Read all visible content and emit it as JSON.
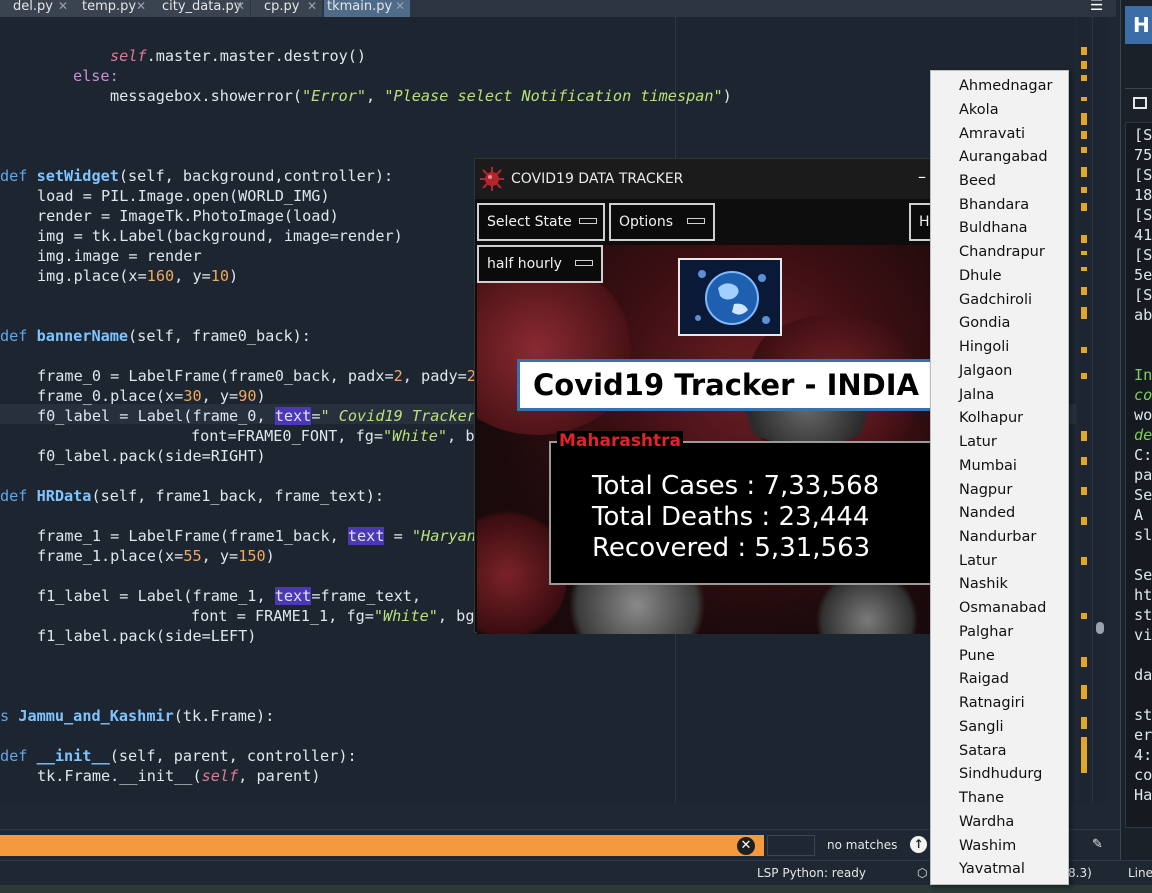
{
  "tabs": [
    {
      "label": "del.py"
    },
    {
      "label": "temp.py"
    },
    {
      "label": "city_data.py"
    },
    {
      "label": "cp.py"
    },
    {
      "label": "tkmain.py"
    }
  ],
  "code": {
    "line1_self": "self",
    "line1_rest": ".master.master.destroy()",
    "line2": "else:",
    "line3_a": "messagebox.showerror(",
    "line3_s1": "\"Error\"",
    "line3_b": ", ",
    "line3_s2": "\"Please select Notification timespan\"",
    "line3_c": ")",
    "setwidget_def": "def",
    "setwidget_name": "setWidget",
    "setwidget_args": "(self, background,controller):",
    "sw1": "load = PIL.Image.open(WORLD_IMG)",
    "sw2": "render = ImageTk.PhotoImage(load)",
    "sw3": "img = tk.Label(background, image=render)",
    "sw4": "img.image = render",
    "sw5_a": "img.place(x=",
    "sw5_n1": "160",
    "sw5_b": ", y=",
    "sw5_n2": "10",
    "sw5_c": ")",
    "banner_def": "def",
    "banner_name": "bannerName",
    "banner_args": "(self, frame0_back):",
    "b1_a": "frame_0 = LabelFrame(frame0_back, padx=",
    "b1_n1": "2",
    "b1_b": ", pady=",
    "b1_n2": "2",
    "b1_c": ",",
    "b2_a": "frame_0.place(x=",
    "b2_n1": "30",
    "b2_b": ", y=",
    "b2_n2": "90",
    "b2_c": ")",
    "b3_a": "f0_label = Label(frame_0, ",
    "b3_kw": "text",
    "b3_b": "=",
    "b3_s": "\" Covid19 Tracker",
    "b4_a": "font=FRAME0_FONT, fg=",
    "b4_s": "\"White\"",
    "b4_b": ", bg",
    "b5": "f0_label.pack(side=RIGHT)",
    "hr_def": "def",
    "hr_name": "HRData",
    "hr_args": "(self, frame1_back, frame_text):",
    "h1_a": "frame_1 = LabelFrame(frame1_back, ",
    "h1_kw": "text",
    "h1_b": " = ",
    "h1_s": "\"Haryana",
    "h2_a": "frame_1.place(x=",
    "h2_n1": "55",
    "h2_b": ", y=",
    "h2_n2": "150",
    "h2_c": ")",
    "h3_a": "f1_label = Label(frame_1, ",
    "h3_kw": "text",
    "h3_b": "=frame_text,",
    "h4_a": "font = FRAME1_1, fg=",
    "h4_s": "\"White\"",
    "h4_b": ", bg",
    "h5": "f1_label.pack(side=LEFT)",
    "class_kw": "s",
    "class_name": "Jammu_and_Kashmir",
    "class_rest": "(tk.Frame):",
    "init_def": "def",
    "init_name": "__init__",
    "init_args": "(self, parent, controller):",
    "i1_a": "tk.Frame.__init__(",
    "i1_self": "self",
    "i1_b": ", parent)"
  },
  "tk_app": {
    "title": "COVID19 DATA TRACKER",
    "minimize": "–",
    "menu_select_state": "Select State",
    "menu_options": "Options",
    "menu_right": "H",
    "timespan": "half hourly",
    "banner": "Covid19 Tracker - INDIA",
    "state_name": "Maharashtra",
    "total_cases": "Total Cases : 7,33,568",
    "total_deaths": "Total Deaths : 23,444",
    "recovered": "Recovered : 5,31,563"
  },
  "dropdown_items": [
    "Ahmednagar",
    "Akola",
    "Amravati",
    "Aurangabad",
    "Beed",
    "Bhandara",
    "Buldhana",
    "Chandrapur",
    "Dhule",
    "Gadchiroli",
    "Gondia",
    "Hingoli",
    "Jalgaon",
    "Jalna",
    "Kolhapur",
    "Latur",
    "Mumbai",
    "Nagpur",
    "Nanded",
    "Nandurbar",
    "Latur",
    "Nashik",
    "Osmanabad",
    "Palghar",
    "Pune",
    "Raigad",
    "Ratnagiri",
    "Sangli",
    "Satara",
    "Sindhudurg",
    "Thane",
    "Wardha",
    "Washim",
    "Yavatmal"
  ],
  "find": {
    "clear": "✕",
    "status": "no matches",
    "prev": "↑"
  },
  "status": {
    "lsp": "LSP Python: ready",
    "python_version": "8.3)",
    "line_col": "Line"
  },
  "right_panel": {
    "header": "H",
    "log_lines": [
      "[S",
      "75",
      "[S",
      "18",
      "[S",
      "41",
      "[S",
      "5e",
      "[S",
      "ab",
      "",
      "",
      "In",
      "co",
      "wo",
      "de",
      "C:",
      "pa",
      "Se",
      "A",
      "sl",
      "",
      "Se",
      "ht",
      "st",
      "vi",
      "",
      "da",
      "",
      "st",
      "er",
      "4:",
      "co",
      "Ha"
    ]
  },
  "colors": {
    "editor_bg": "#1c2530",
    "find_orange": "#f39a3e",
    "banner_border": "#3a6fb0",
    "state_red": "#e0242a",
    "minimap_marks": "#e0a72a"
  },
  "icons": [
    "close-icon",
    "menu-icon",
    "virus-icon",
    "globe-icon",
    "search-up-icon",
    "folder-icon",
    "lsp-icon",
    "brush-icon"
  ]
}
